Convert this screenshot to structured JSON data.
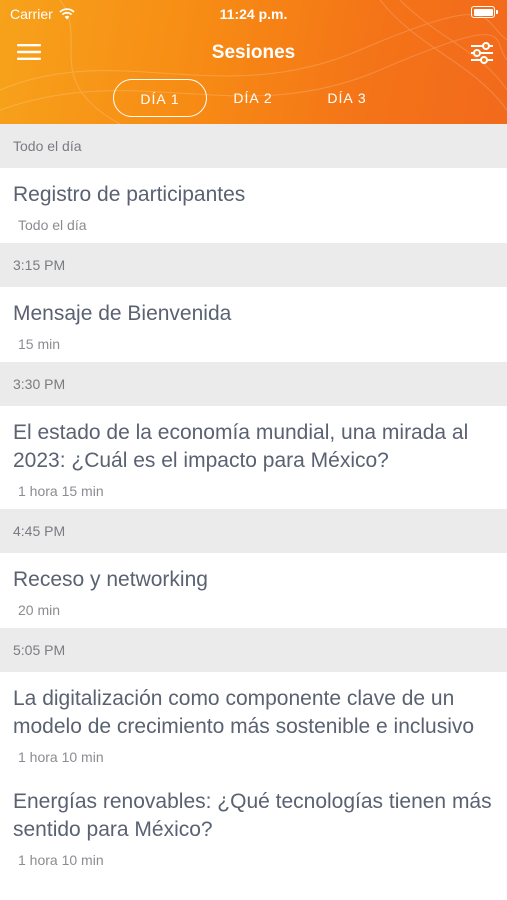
{
  "status_bar": {
    "carrier": "Carrier",
    "time": "11:24 p.m."
  },
  "header": {
    "title": "Sesiones",
    "gradient_colors": [
      "#f7a21b",
      "#f47218"
    ],
    "tabs": [
      {
        "label": "DÍA 1",
        "active": true
      },
      {
        "label": "DÍA 2",
        "active": false
      },
      {
        "label": "DÍA 3",
        "active": false
      }
    ]
  },
  "sessions": [
    {
      "time_header": "Todo el día",
      "title": "Registro de participantes",
      "duration": "Todo el día"
    },
    {
      "time_header": "3:15 PM",
      "title": "Mensaje de Bienvenida",
      "duration": "15 min"
    },
    {
      "time_header": "3:30 PM",
      "title": "El estado de la economía mundial, una mirada al 2023: ¿Cuál es el impacto para México?",
      "duration": "1 hora 15 min"
    },
    {
      "time_header": "4:45 PM",
      "title": "Receso y networking",
      "duration": "20 min"
    },
    {
      "time_header": "5:05 PM",
      "title": "La digitalización como componente clave de un modelo de crecimiento más sostenible e inclusivo",
      "duration": "1 hora 10 min"
    },
    {
      "time_header": "",
      "title": "Energías renovables: ¿Qué tecnologías tienen más sentido para México?",
      "duration": "1 hora 10 min"
    }
  ]
}
